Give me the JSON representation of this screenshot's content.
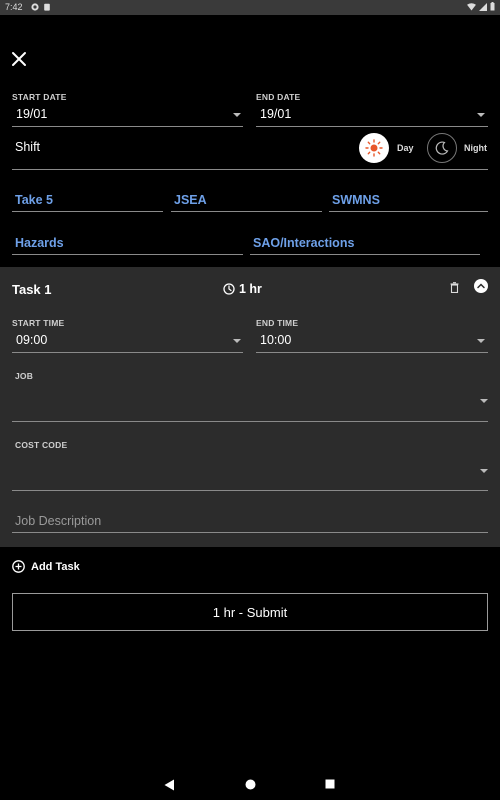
{
  "status": {
    "time": "7:42"
  },
  "form": {
    "start_date_label": "START DATE",
    "start_date_value": "19/01",
    "end_date_label": "END DATE",
    "end_date_value": "19/01",
    "shift_label": "Shift",
    "day_label": "Day",
    "night_label": "Night",
    "links": [
      "Take 5",
      "JSEA",
      "SWMNS",
      "Hazards",
      "SAO/Interactions"
    ]
  },
  "task": {
    "title": "Task 1",
    "duration": "1 hr",
    "start_time_label": "START TIME",
    "start_time_value": "09:00",
    "end_time_label": "END TIME",
    "end_time_value": "10:00",
    "job_label": "JOB",
    "job_value": "",
    "cost_code_label": "COST CODE",
    "cost_code_value": "",
    "description_placeholder": "Job Description"
  },
  "add_task_label": "Add Task",
  "submit_label": "1 hr - Submit",
  "colors": {
    "link": "#6ea0e8",
    "card": "#2c2c2c",
    "sun": "#e8572a"
  }
}
